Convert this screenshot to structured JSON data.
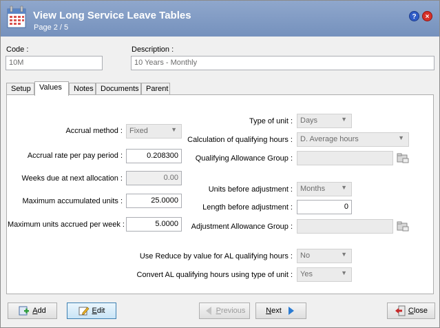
{
  "window": {
    "title": "View Long Service Leave Tables",
    "subtitle": "Page 2 / 5",
    "help_icon": "question-icon",
    "close_icon": "close-icon"
  },
  "header": {
    "code_label": "Code :",
    "code_value": "10M",
    "description_label": "Description :",
    "description_value": "10 Years - Monthly"
  },
  "tabs": [
    {
      "label": "Setup",
      "active": false
    },
    {
      "label": "Values",
      "active": true
    },
    {
      "label": "Notes",
      "active": false
    },
    {
      "label": "Documents",
      "active": false
    },
    {
      "label": "Parent",
      "active": false
    }
  ],
  "values_tab": {
    "type_of_unit": {
      "label": "Type of unit :",
      "value": "Days"
    },
    "accrual_method": {
      "label": "Accrual method :",
      "value": "Fixed"
    },
    "calc_qualifying_hours": {
      "label": "Calculation of qualifying hours :",
      "value": "D. Average hours"
    },
    "accrual_rate": {
      "label": "Accrual rate per pay period :",
      "value": "0.208300"
    },
    "qualifying_allowance_group": {
      "label": "Qualifying Allowance Group :",
      "value": ""
    },
    "weeks_due": {
      "label": "Weeks due at next allocation :",
      "value": "0.00"
    },
    "units_before_adjustment": {
      "label": "Units before adjustment :",
      "value": "Months"
    },
    "max_accumulated_units": {
      "label": "Maximum accumulated units :",
      "value": "25.0000"
    },
    "length_before_adjustment": {
      "label": "Length before adjustment :",
      "value": "0"
    },
    "max_units_per_week": {
      "label": "Maximum units accrued per week :",
      "value": "5.0000"
    },
    "adjustment_allowance_group": {
      "label": "Adjustment Allowance Group :",
      "value": ""
    },
    "use_reduce_by": {
      "label": "Use Reduce by value for AL qualifying hours :",
      "value": "No"
    },
    "convert_al_hours": {
      "label": "Convert AL qualifying hours using type of unit :",
      "value": "Yes"
    }
  },
  "buttons": {
    "add_mnemonic": "A",
    "add_rest": "dd",
    "edit_mnemonic": "E",
    "edit_rest": "dit",
    "previous_mnemonic": "P",
    "previous_rest": "revious",
    "next_mnemonic": "N",
    "next_rest": "ext",
    "close_mnemonic": "C",
    "close_rest": "lose"
  },
  "colors": {
    "titlebar": "#7f9ac4",
    "accent": "#3c7fb1",
    "disabled_text": "#9a9a9a"
  }
}
